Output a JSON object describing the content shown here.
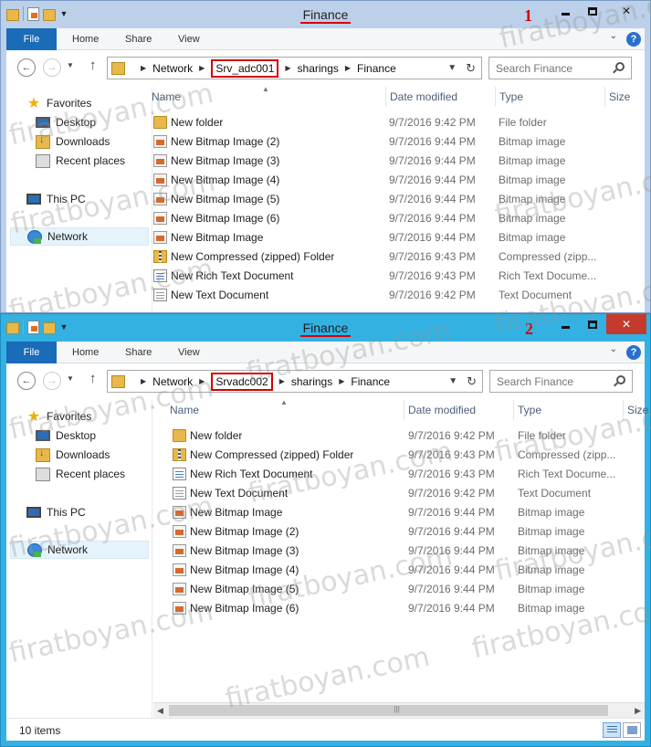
{
  "watermark": "firatboyan.com",
  "windows": [
    {
      "number": "1",
      "title": "Finance",
      "tabs": [
        "File",
        "Home",
        "Share",
        "View"
      ],
      "path": [
        "Network",
        "Srv_adc001",
        "sharings",
        "Finance"
      ],
      "highlight_index": 1,
      "search_placeholder": "Search Finance",
      "nav": {
        "favorites": "Favorites",
        "desktop": "Desktop",
        "downloads": "Downloads",
        "recent": "Recent places",
        "thispc": "This PC",
        "network": "Network"
      },
      "columns": [
        "Name",
        "Date modified",
        "Type",
        "Size"
      ],
      "files": [
        {
          "name": "New folder",
          "date": "9/7/2016 9:42 PM",
          "type": "File folder",
          "icon": "folder-icon"
        },
        {
          "name": "New Bitmap Image (2)",
          "date": "9/7/2016 9:44 PM",
          "type": "Bitmap image",
          "icon": "bitmap-icon"
        },
        {
          "name": "New Bitmap Image (3)",
          "date": "9/7/2016 9:44 PM",
          "type": "Bitmap image",
          "icon": "bitmap-icon"
        },
        {
          "name": "New Bitmap Image (4)",
          "date": "9/7/2016 9:44 PM",
          "type": "Bitmap image",
          "icon": "bitmap-icon"
        },
        {
          "name": "New Bitmap Image (5)",
          "date": "9/7/2016 9:44 PM",
          "type": "Bitmap image",
          "icon": "bitmap-icon"
        },
        {
          "name": "New Bitmap Image (6)",
          "date": "9/7/2016 9:44 PM",
          "type": "Bitmap image",
          "icon": "bitmap-icon"
        },
        {
          "name": "New Bitmap Image",
          "date": "9/7/2016 9:44 PM",
          "type": "Bitmap image",
          "icon": "bitmap-icon"
        },
        {
          "name": "New Compressed (zipped) Folder",
          "date": "9/7/2016 9:43 PM",
          "type": "Compressed (zipp...",
          "icon": "zip-icon"
        },
        {
          "name": "New Rich Text Document",
          "date": "9/7/2016 9:43 PM",
          "type": "Rich Text Docume...",
          "icon": "rtf-icon"
        },
        {
          "name": "New Text Document",
          "date": "9/7/2016 9:42 PM",
          "type": "Text Document",
          "icon": "txt-icon"
        }
      ]
    },
    {
      "number": "2",
      "title": "Finance",
      "tabs": [
        "File",
        "Home",
        "Share",
        "View"
      ],
      "path": [
        "Network",
        "Srvadc002",
        "sharings",
        "Finance"
      ],
      "highlight_index": 1,
      "search_placeholder": "Search Finance",
      "nav": {
        "favorites": "Favorites",
        "desktop": "Desktop",
        "downloads": "Downloads",
        "recent": "Recent places",
        "thispc": "This PC",
        "network": "Network"
      },
      "columns": [
        "Name",
        "Date modified",
        "Type",
        "Size"
      ],
      "files": [
        {
          "name": "New folder",
          "date": "9/7/2016 9:42 PM",
          "type": "File folder",
          "icon": "folder-icon"
        },
        {
          "name": "New Compressed (zipped) Folder",
          "date": "9/7/2016 9:43 PM",
          "type": "Compressed (zipp...",
          "icon": "zip-icon"
        },
        {
          "name": "New Rich Text Document",
          "date": "9/7/2016 9:43 PM",
          "type": "Rich Text Docume...",
          "icon": "rtf-icon"
        },
        {
          "name": "New Text Document",
          "date": "9/7/2016 9:42 PM",
          "type": "Text Document",
          "icon": "txt-icon"
        },
        {
          "name": "New Bitmap Image",
          "date": "9/7/2016 9:44 PM",
          "type": "Bitmap image",
          "icon": "bitmap-icon"
        },
        {
          "name": "New Bitmap Image (2)",
          "date": "9/7/2016 9:44 PM",
          "type": "Bitmap image",
          "icon": "bitmap-icon"
        },
        {
          "name": "New Bitmap Image (3)",
          "date": "9/7/2016 9:44 PM",
          "type": "Bitmap image",
          "icon": "bitmap-icon"
        },
        {
          "name": "New Bitmap Image (4)",
          "date": "9/7/2016 9:44 PM",
          "type": "Bitmap image",
          "icon": "bitmap-icon"
        },
        {
          "name": "New Bitmap Image (5)",
          "date": "9/7/2016 9:44 PM",
          "type": "Bitmap image",
          "icon": "bitmap-icon"
        },
        {
          "name": "New Bitmap Image (6)",
          "date": "9/7/2016 9:44 PM",
          "type": "Bitmap image",
          "icon": "bitmap-icon"
        }
      ],
      "status": "10 items"
    }
  ]
}
